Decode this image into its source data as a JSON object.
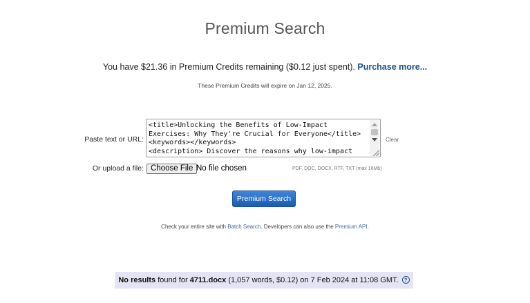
{
  "page": {
    "title": "Premium Search"
  },
  "credits": {
    "prefix": "You have $21.36 in Premium Credits remaining ($0.12 just spent).",
    "purchase_link": "Purchase more...",
    "expiry": "These Premium Credits will expire on Jan 12, 2025."
  },
  "form": {
    "paste_label": "Paste text or URL:",
    "textarea_value": "<title>Unlocking the Benefits of Low-Impact Exercises: Why They're Crucial for Everyone</title>\n<keywords></keywords>\n<description> Discover the reasons why low-impact",
    "clear_label": "Clear",
    "upload_label": "Or upload a file:",
    "file_button": "Choose File",
    "file_status": "No file chosen",
    "file_hint": "PDF, DOC, DOCX, RTF, TXT (max 16Mb)",
    "search_button": "Premium Search"
  },
  "footer": {
    "part1": "Check your entire site with",
    "batch_link": "Batch Search",
    "part2": ". Developers can also use the",
    "api_link": "Premium API",
    "part3": "."
  },
  "result": {
    "no_results": "No results",
    "found_for": "found for",
    "filename": "4711.docx",
    "details": "(1,057 words, $0.12) on 7 Feb 2024 at 11:08 GMT.",
    "help_icon": "?"
  }
}
